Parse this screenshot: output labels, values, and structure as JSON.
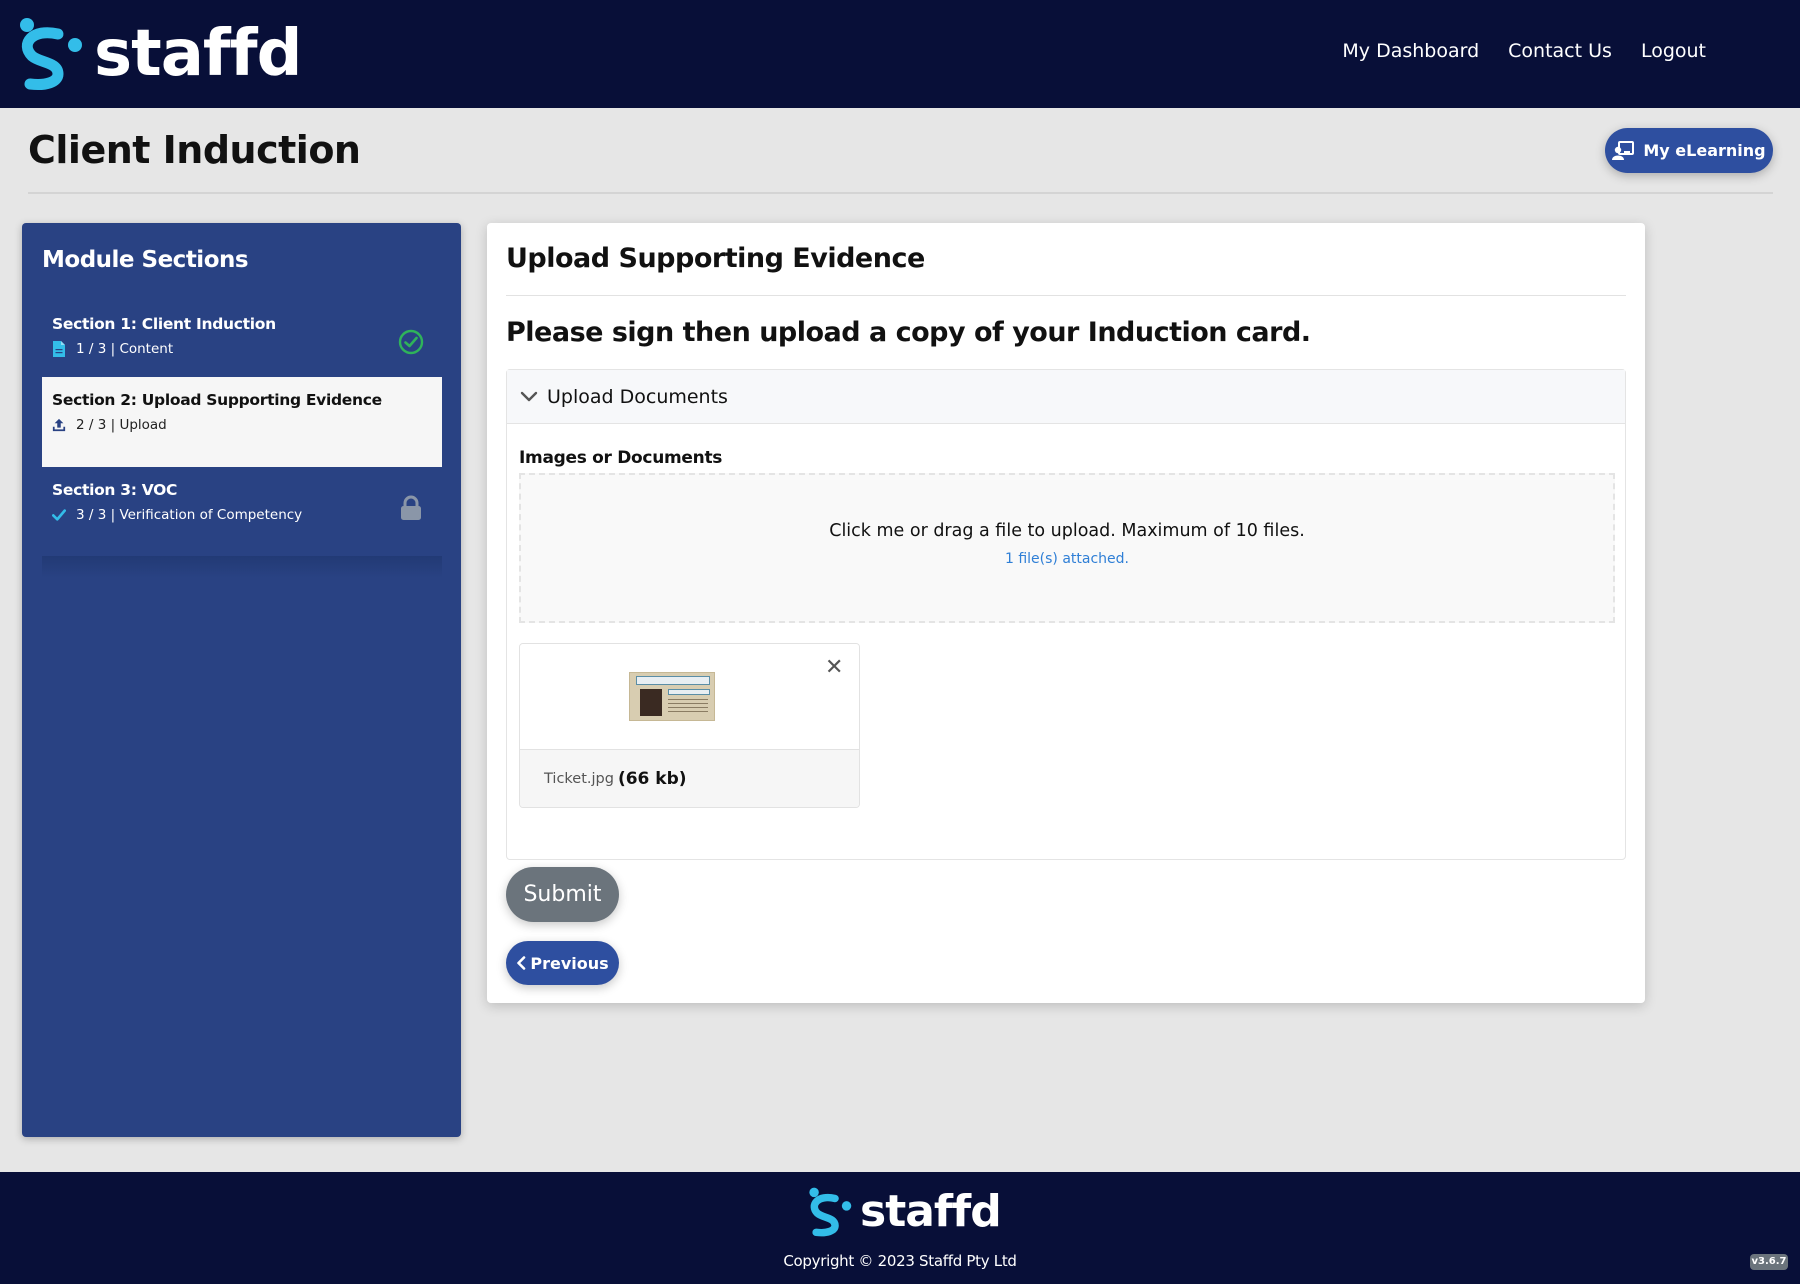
{
  "brand": {
    "name": "staffd",
    "accent_color": "#33bde9",
    "header_bg": "#080f38"
  },
  "nav": {
    "items": [
      {
        "label": "My Dashboard"
      },
      {
        "label": "Contact Us"
      },
      {
        "label": "Logout"
      }
    ]
  },
  "page": {
    "title": "Client Induction",
    "elearning_button": "My eLearning",
    "elearning_icon": "chalkboard-teacher-icon"
  },
  "sidebar": {
    "heading": "Module Sections",
    "sections": [
      {
        "title": "Section 1: Client Induction",
        "meta": "1 / 3 | Content",
        "icon": "file-icon",
        "status": "completed",
        "status_icon": "check-circle-icon",
        "active": false
      },
      {
        "title": "Section 2: Upload Supporting Evidence",
        "meta": "2 / 3 | Upload",
        "icon": "upload-icon",
        "status": "current",
        "active": true
      },
      {
        "title": "Section 3: VOC",
        "meta": "3 / 3 | Verification of Competency",
        "icon": "check-icon",
        "status": "locked",
        "status_icon": "lock-icon",
        "active": false
      }
    ]
  },
  "main": {
    "title": "Upload Supporting Evidence",
    "instruction": "Please sign then upload a copy of your Induction card.",
    "accordion": {
      "header": "Upload Documents",
      "expanded": true,
      "field_label": "Images or Documents",
      "dropzone_text": "Click me or drag a file to upload. Maximum of 10 files.",
      "attached_text": "1 file(s) attached.",
      "files": [
        {
          "name": "Ticket.jpg",
          "size": "(66 kb)"
        }
      ]
    },
    "submit_label": "Submit",
    "previous_label": "Previous"
  },
  "footer": {
    "copyright": "Copyright © 2023 Staffd Pty Ltd",
    "version": "v3.6.7"
  }
}
